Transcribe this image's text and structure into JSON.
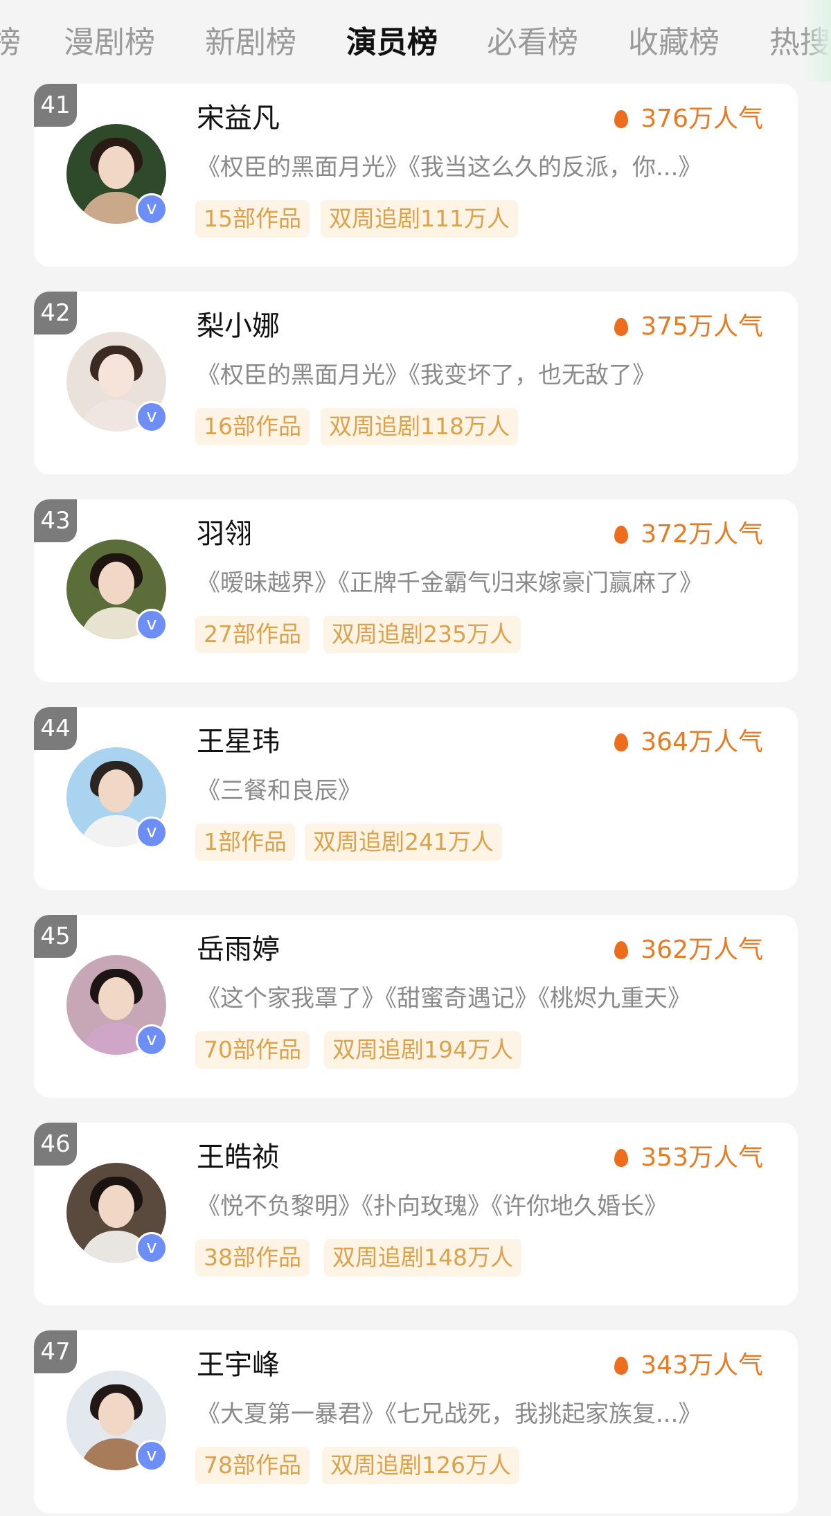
{
  "tabs": [
    "榜",
    "漫剧榜",
    "新剧榜",
    "演员榜",
    "必看榜",
    "收藏榜",
    "热搜"
  ],
  "active_tab": "演员榜",
  "colors": {
    "accent_orange": "#ea7a22",
    "tag_bg": "#fdf4e6",
    "tag_text": "#dda14a",
    "verified_blue": "#6d8ef5"
  },
  "icons": {
    "verified": "v-badge-icon",
    "popularity": "fire-icon"
  },
  "verified_label": "v",
  "actors": [
    {
      "rank": "41",
      "name": "宋益凡",
      "popularity": "376万人气",
      "works": "《权臣的黑面月光》《我当这么久的反派，你...》",
      "count_tag": "15部作品",
      "follow_tag": "双周追剧111万人"
    },
    {
      "rank": "42",
      "name": "梨小娜",
      "popularity": "375万人气",
      "works": "《权臣的黑面月光》《我变坏了，也无敌了》",
      "count_tag": "16部作品",
      "follow_tag": "双周追剧118万人"
    },
    {
      "rank": "43",
      "name": "羽翎",
      "popularity": "372万人气",
      "works": "《暧昧越界》《正牌千金霸气归来嫁豪门赢麻了》",
      "count_tag": "27部作品",
      "follow_tag": "双周追剧235万人"
    },
    {
      "rank": "44",
      "name": "王星玮",
      "popularity": "364万人气",
      "works": "《三餐和良辰》",
      "count_tag": "1部作品",
      "follow_tag": "双周追剧241万人"
    },
    {
      "rank": "45",
      "name": "岳雨婷",
      "popularity": "362万人气",
      "works": "《这个家我罩了》《甜蜜奇遇记》《桃烬九重天》",
      "count_tag": "70部作品",
      "follow_tag": "双周追剧194万人"
    },
    {
      "rank": "46",
      "name": "王皓祯",
      "popularity": "353万人气",
      "works": "《悦不负黎明》《扑向玫瑰》《许你地久婚长》",
      "count_tag": "38部作品",
      "follow_tag": "双周追剧148万人"
    },
    {
      "rank": "47",
      "name": "王宇峰",
      "popularity": "343万人气",
      "works": "《大夏第一暴君》《七兄战死，我挑起家族复...》",
      "count_tag": "78部作品",
      "follow_tag": "双周追剧126万人"
    }
  ]
}
